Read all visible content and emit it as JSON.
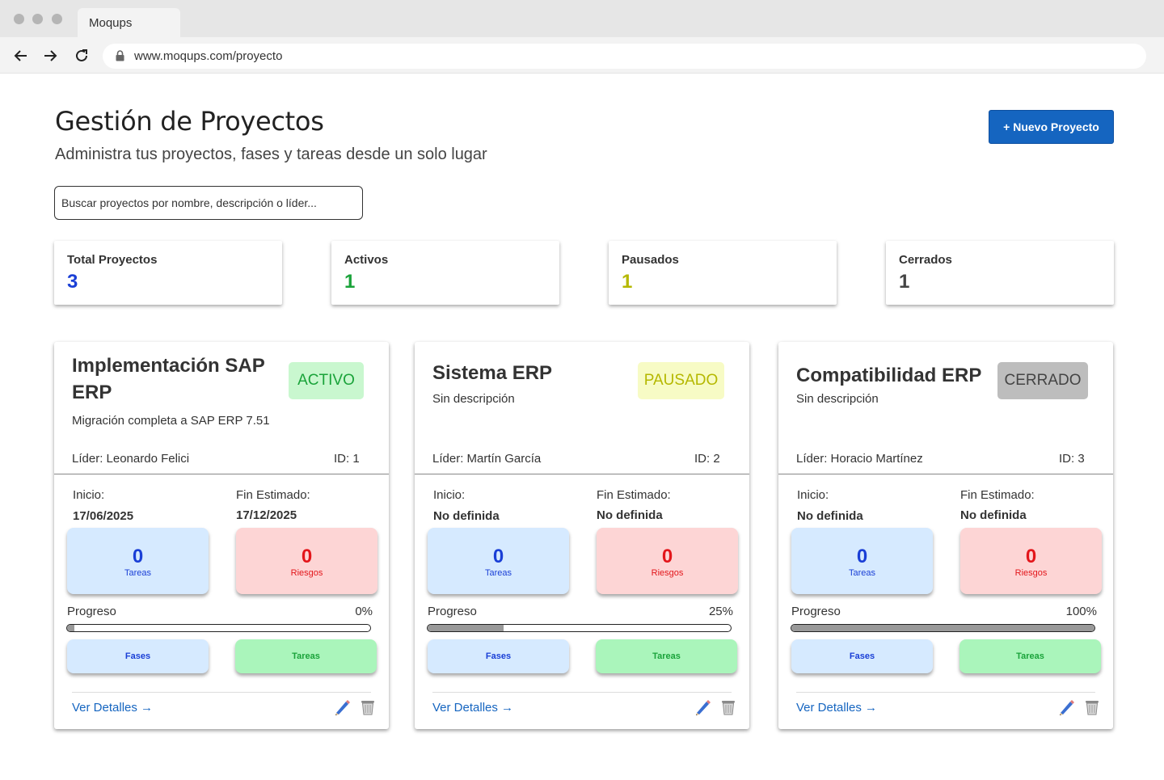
{
  "browser": {
    "tab_title": "Moqups",
    "url": "www.moqups.com/proyecto"
  },
  "header": {
    "title": "Gestión de Proyectos",
    "subtitle": "Administra tus proyectos, fases y tareas desde un solo lugar",
    "new_button": "+ Nuevo Proyecto"
  },
  "search": {
    "placeholder": "Buscar proyectos por nombre, descripción o líder..."
  },
  "stats": [
    {
      "label": "Total Proyectos",
      "value": "3",
      "color": "#1a3fd6"
    },
    {
      "label": "Activos",
      "value": "1",
      "color": "#1aa33a"
    },
    {
      "label": "Pausados",
      "value": "1",
      "color": "#b5b800"
    },
    {
      "label": "Cerrados",
      "value": "1",
      "color": "#444444"
    }
  ],
  "labels": {
    "leader_prefix": "Líder:",
    "id_prefix": "ID:",
    "start": "Inicio:",
    "end": "Fin Estimado:",
    "tasks_metric": "Tareas",
    "risks_metric": "Riesgos",
    "progress": "Progreso",
    "phases_button": "Fases",
    "tasks_button": "Tareas",
    "details_link": "Ver Detalles →"
  },
  "projects": [
    {
      "title": "Implementación SAP ERP",
      "description": "Migración completa a SAP ERP 7.51",
      "status": "ACTIVO",
      "status_bg": "#c9f7cf",
      "status_color": "#1aa33a",
      "leader": "Líder: Leonardo Felici",
      "id": "ID: 1",
      "start": "17/06/2025",
      "end": "17/12/2025",
      "tasks": "0",
      "risks": "0",
      "progress_label": "0%",
      "progress": 0.0
    },
    {
      "title": "Sistema ERP",
      "description": "Sin descripción",
      "status": "PAUSADO",
      "status_bg": "#f7fbc5",
      "status_color": "#b5b800",
      "leader": "Líder: Martín García",
      "id": "ID: 2",
      "start": "No definida",
      "end": "No definida",
      "tasks": "0",
      "risks": "0",
      "progress_label": "25%",
      "progress": 0.25
    },
    {
      "title": "Compatibilidad ERP",
      "description": "Sin descripción",
      "status": "CERRADO",
      "status_bg": "#bdbdbd",
      "status_color": "#444444",
      "leader": "Líder: Horacio Martínez",
      "id": "ID: 3",
      "start": "No definida",
      "end": "No definida",
      "tasks": "0",
      "risks": "0",
      "progress_label": "100%",
      "progress": 1.0
    }
  ]
}
